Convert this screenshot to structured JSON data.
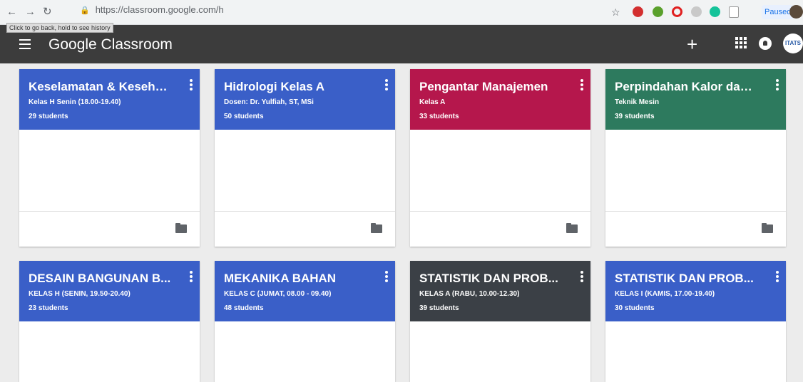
{
  "browser": {
    "url": "https://classroom.google.com/h",
    "tooltip": "Click to go back, hold to see history",
    "paused_label": "Paused"
  },
  "app": {
    "title": "Google Classroom",
    "avatar_label": "ITATS"
  },
  "colors": {
    "header": "#3c3c3c",
    "blue": "#3a5fc8",
    "magenta": "#b5174c",
    "teal": "#2d7a5e",
    "gray": "#3b4046"
  },
  "classes": [
    {
      "title": "Keselamatan & Keseha...",
      "subtitle": "Kelas H Senin (18.00-19.40)",
      "students": "29 students",
      "theme": "blue"
    },
    {
      "title": "Hidrologi Kelas A",
      "subtitle": "Dosen: Dr. Yulfiah, ST, MSi",
      "students": "50 students",
      "theme": "blue"
    },
    {
      "title": "Pengantar Manajemen",
      "subtitle": "Kelas A",
      "students": "33 students",
      "theme": "magenta"
    },
    {
      "title": "Perpindahan Kalor dan...",
      "subtitle": "Teknik Mesin",
      "students": "39 students",
      "theme": "teal"
    },
    {
      "title": "DESAIN BANGUNAN B...",
      "subtitle": "KELAS H (SENIN, 19.50-20.40)",
      "students": "23 students",
      "theme": "blue"
    },
    {
      "title": "MEKANIKA BAHAN",
      "subtitle": "KELAS C (JUMAT, 08.00 - 09.40)",
      "students": "48 students",
      "theme": "blue"
    },
    {
      "title": "STATISTIK DAN PROB...",
      "subtitle": "KELAS A (RABU, 10.00-12.30)",
      "students": "39 students",
      "theme": "gray"
    },
    {
      "title": "STATISTIK DAN PROB...",
      "subtitle": "KELAS I (KAMIS, 17.00-19.40)",
      "students": "30 students",
      "theme": "blue"
    }
  ]
}
